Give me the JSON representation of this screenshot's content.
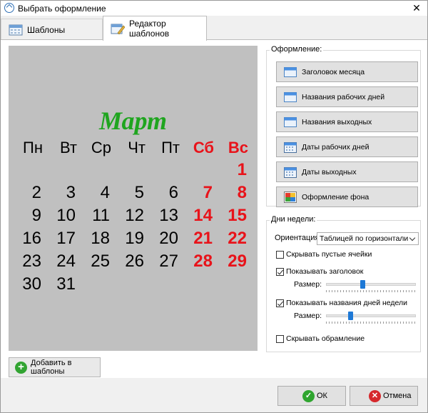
{
  "window": {
    "title": "Выбрать оформление",
    "close_glyph": "✕"
  },
  "tabs": [
    {
      "label": "Шаблоны",
      "icon": "calendar-icon",
      "active": false
    },
    {
      "label": "Редактор шаблонов",
      "icon": "calendar-edit-icon",
      "active": true
    }
  ],
  "calendar": {
    "month": "Март",
    "weekdays": [
      "Пн",
      "Вт",
      "Ср",
      "Чт",
      "Пт",
      "Сб",
      "Вс"
    ],
    "weekend_columns": [
      5,
      6
    ],
    "weeks": [
      [
        "",
        "",
        "",
        "",
        "",
        "",
        "1"
      ],
      [
        "2",
        "3",
        "4",
        "5",
        "6",
        "7",
        "8"
      ],
      [
        "9",
        "10",
        "11",
        "12",
        "13",
        "14",
        "15"
      ],
      [
        "16",
        "17",
        "18",
        "19",
        "20",
        "21",
        "22"
      ],
      [
        "23",
        "24",
        "25",
        "26",
        "27",
        "28",
        "29"
      ],
      [
        "30",
        "31",
        "",
        "",
        "",
        "",
        ""
      ]
    ],
    "colors": {
      "month": "#1fa51f",
      "weekend": "#e8131a",
      "background": "#c0c0c0"
    }
  },
  "add_to_templates": {
    "label": "Добавить в шаблоны",
    "icon": "plus-circle-icon"
  },
  "styling": {
    "group_title": "Оформление:",
    "buttons": [
      {
        "label": "Заголовок месяца",
        "icon": "window-icon"
      },
      {
        "label": "Названия рабочих дней",
        "icon": "window-icon"
      },
      {
        "label": "Названия выходных",
        "icon": "window-icon"
      },
      {
        "label": "Даты рабочих дней",
        "icon": "calendar-icon"
      },
      {
        "label": "Даты выходных",
        "icon": "calendar-icon"
      },
      {
        "label": "Оформление фона",
        "icon": "palette-icon"
      }
    ]
  },
  "weekdays_group": {
    "group_title": "Дни недели:",
    "orientation_label": "Ориентация:",
    "orientation_value": "Таблицей по горизонтали",
    "hide_empty_cells": {
      "label": "Скрывать пустые ячейки",
      "checked": false
    },
    "show_header": {
      "label": "Показывать заголовок",
      "checked": true
    },
    "header_size": {
      "label": "Размер:",
      "value": 0.4
    },
    "show_weekday_names": {
      "label": "Показывать названия дней недели",
      "checked": true
    },
    "weekday_names_size": {
      "label": "Размер:",
      "value": 0.26
    },
    "hide_border": {
      "label": "Скрывать обрамление",
      "checked": false
    }
  },
  "footer": {
    "ok_label": "ОК",
    "cancel_label": "Отмена",
    "ok_color": "#2fa52f",
    "cancel_color": "#d6282c"
  }
}
